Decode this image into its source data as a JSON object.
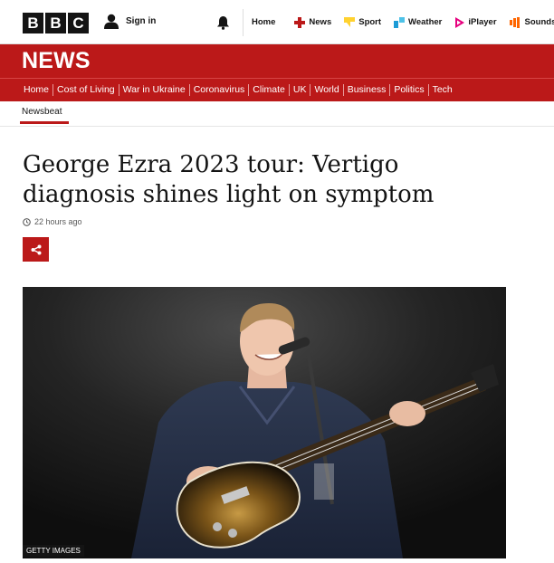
{
  "header": {
    "logo_letters": [
      "B",
      "B",
      "C"
    ],
    "signin_label": "Sign in",
    "nav": [
      {
        "label": "Home",
        "icon": "none"
      },
      {
        "label": "News",
        "icon": "news-icon",
        "color": "#bb1919"
      },
      {
        "label": "Sport",
        "icon": "sport-icon",
        "color": "#ffd230"
      },
      {
        "label": "Weather",
        "icon": "weather-icon",
        "color": "#1d9bd6"
      },
      {
        "label": "iPlayer",
        "icon": "iplayer-icon",
        "color": "#e6007e"
      },
      {
        "label": "Sounds",
        "icon": "sounds-icon",
        "color": "#ff6600"
      }
    ]
  },
  "section": {
    "title": "NEWS",
    "nav": [
      "Home",
      "Cost of Living",
      "War in Ukraine",
      "Coronavirus",
      "Climate",
      "UK",
      "World",
      "Business",
      "Politics",
      "Tech"
    ],
    "subsection": "Newsbeat"
  },
  "article": {
    "headline": "George Ezra 2023 tour: Vertigo diagnosis shines light on symptom",
    "timestamp": "22 hours ago",
    "image_credit": "GETTY IMAGES"
  },
  "colors": {
    "brand_red": "#bb1919",
    "ink": "#141414"
  }
}
